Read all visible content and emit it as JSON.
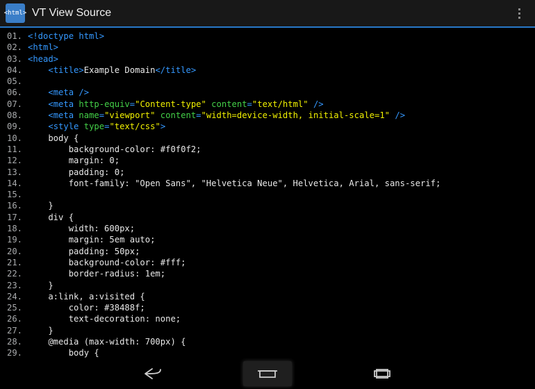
{
  "header": {
    "title": "VT View Source",
    "icon_label": "<html>"
  },
  "code": {
    "lines": [
      [
        [
          "tag",
          "<!doctype html>"
        ]
      ],
      [
        [
          "tag",
          "<html>"
        ]
      ],
      [
        [
          "tag",
          "<head>"
        ]
      ],
      [
        [
          "plain",
          "    "
        ],
        [
          "tag",
          "<title>"
        ],
        [
          "plain",
          "Example Domain"
        ],
        [
          "tag",
          "</title>"
        ]
      ],
      [],
      [
        [
          "plain",
          "    "
        ],
        [
          "tag",
          "<meta />"
        ]
      ],
      [
        [
          "plain",
          "    "
        ],
        [
          "tag",
          "<meta "
        ],
        [
          "attr",
          "http-equiv"
        ],
        [
          "tag",
          "="
        ],
        [
          "str",
          "\"Content-type\""
        ],
        [
          "attr",
          " content"
        ],
        [
          "tag",
          "="
        ],
        [
          "str",
          "\"text/html\""
        ],
        [
          "tag",
          " />"
        ]
      ],
      [
        [
          "plain",
          "    "
        ],
        [
          "tag",
          "<meta "
        ],
        [
          "attr",
          "name"
        ],
        [
          "tag",
          "="
        ],
        [
          "str",
          "\"viewport\""
        ],
        [
          "attr",
          " content"
        ],
        [
          "tag",
          "="
        ],
        [
          "str",
          "\"width=device-width, initial-scale=1\""
        ],
        [
          "tag",
          " />"
        ]
      ],
      [
        [
          "plain",
          "    "
        ],
        [
          "tag",
          "<style "
        ],
        [
          "attr",
          "type"
        ],
        [
          "tag",
          "="
        ],
        [
          "str",
          "\"text/css\""
        ],
        [
          "tag",
          ">"
        ]
      ],
      [
        [
          "plain",
          "    body {"
        ]
      ],
      [
        [
          "plain",
          "        background-color: #f0f0f2;"
        ]
      ],
      [
        [
          "plain",
          "        margin: 0;"
        ]
      ],
      [
        [
          "plain",
          "        padding: 0;"
        ]
      ],
      [
        [
          "plain",
          "        font-family: \"Open Sans\", \"Helvetica Neue\", Helvetica, Arial, sans-serif;"
        ]
      ],
      [],
      [
        [
          "plain",
          "    }"
        ]
      ],
      [
        [
          "plain",
          "    div {"
        ]
      ],
      [
        [
          "plain",
          "        width: 600px;"
        ]
      ],
      [
        [
          "plain",
          "        margin: 5em auto;"
        ]
      ],
      [
        [
          "plain",
          "        padding: 50px;"
        ]
      ],
      [
        [
          "plain",
          "        background-color: #fff;"
        ]
      ],
      [
        [
          "plain",
          "        border-radius: 1em;"
        ]
      ],
      [
        [
          "plain",
          "    }"
        ]
      ],
      [
        [
          "plain",
          "    a:link, a:visited {"
        ]
      ],
      [
        [
          "plain",
          "        color: #38488f;"
        ]
      ],
      [
        [
          "plain",
          "        text-decoration: none;"
        ]
      ],
      [
        [
          "plain",
          "    }"
        ]
      ],
      [
        [
          "plain",
          "    @media (max-width: 700px) {"
        ]
      ],
      [
        [
          "plain",
          "        body {"
        ]
      ]
    ]
  }
}
